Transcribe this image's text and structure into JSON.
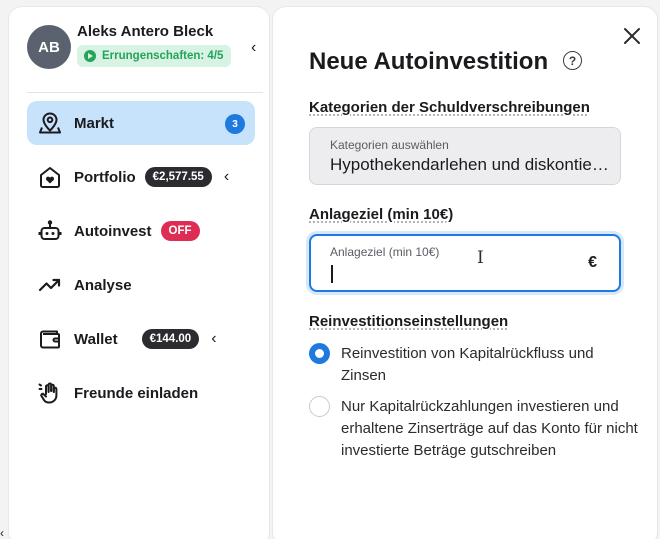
{
  "profile": {
    "initials": "AB",
    "name": "Aleks Antero Bleck",
    "achievements": "Errungenschaften: 4/5"
  },
  "nav": {
    "items": [
      {
        "label": "Markt",
        "icon": "map-pin-icon",
        "badge": "3",
        "active": true
      },
      {
        "label": "Portfolio",
        "icon": "heart-bag-icon",
        "pill": "€2,577.55"
      },
      {
        "label": "Autoinvest",
        "icon": "robot-icon",
        "pill": "OFF"
      },
      {
        "label": "Analyse",
        "icon": "trend-up-icon"
      },
      {
        "label": "Wallet",
        "icon": "wallet-icon",
        "pill": "€144.00"
      },
      {
        "label": "Freunde einladen",
        "icon": "hand-wave-icon"
      }
    ]
  },
  "panel": {
    "title": "Neue Autoinvestition",
    "help": "?",
    "categories": {
      "section_label": "Kategorien der Schuldverschreibungen",
      "select_label": "Kategorien auswählen",
      "select_value": "Hypothekendarlehen und diskontierte Forderungen"
    },
    "target": {
      "section_label": "Anlageziel (min 10€)",
      "input_label": "Anlageziel (min 10€)",
      "currency": "€"
    },
    "reinvest": {
      "section_label": "Reinvestitionseinstellungen",
      "options": [
        {
          "label": "Reinvestition von Kapitalrückfluss und Zinsen",
          "checked": true
        },
        {
          "label": "Nur Kapitalrückzahlungen investieren und erhaltene Zinserträge auf das Konto für nicht investierte Beträge gutschreiben",
          "checked": false
        }
      ]
    }
  },
  "colors": {
    "accent": "#1f7ae0",
    "active_bg": "#c7e2fb",
    "success": "#24a35a",
    "danger": "#dd2d55"
  }
}
